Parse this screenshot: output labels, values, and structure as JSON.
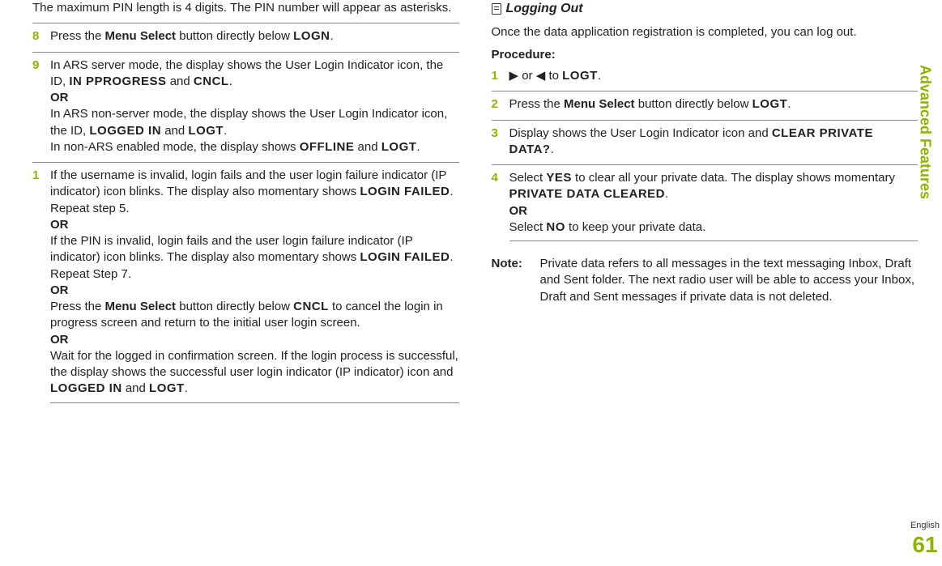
{
  "left": {
    "intro": "The maximum PIN length is 4 digits. The PIN number will appear as asterisks.",
    "s8_num": "8",
    "s8_a": "Press the ",
    "s8_b": "Menu Select",
    "s8_c": " button directly below ",
    "s8_logn": "LOGN",
    "s8_d": ".",
    "s9_num": "9",
    "s9_a": "In ARS server mode, the display shows the User Login Indicator icon, the ID, ",
    "s9_inprog": "IN PPROGRESS",
    "s9_and": " and ",
    "s9_cncl": "CNCL",
    "s9_dot": ".",
    "s9_or1": "OR",
    "s9_b": "In ARS non-server mode, the display shows the User Login Indicator icon, the ID, ",
    "s9_logged": "LOGGED IN",
    "s9_and2": " and ",
    "s9_logt": "LOGT",
    "s9_dot2": ".",
    "s9_c": "In non-ARS enabled mode, the display shows ",
    "s9_offline": "OFFLINE",
    "s9_and3": " and ",
    "s9_logt2": "LOGT",
    "s9_dot3": ".",
    "s1_num": "1",
    "s1_a": "If the username is invalid, login fails and the user login failure indicator (IP indicator) icon blinks. The display also momentary shows ",
    "s1_fail": "LOGIN FAILED",
    "s1_b": ". Repeat step 5.",
    "s1_or1": "OR",
    "s1_c": "If the PIN is invalid, login fails and the user login failure indicator (IP indicator) icon blinks. The display also momentary shows ",
    "s1_fail2": "LOGIN FAILED",
    "s1_d": ". Repeat Step 7.",
    "s1_or2": "OR",
    "s1_e": "Press the ",
    "s1_ms": "Menu Select",
    "s1_f": " button directly below ",
    "s1_cncl": "CNCL",
    "s1_g": " to cancel the login in progress screen and return to the initial user login screen.",
    "s1_or3": "OR",
    "s1_h": "Wait for the logged in confirmation screen. If the login process is successful, the display shows the successful user login indicator (IP indicator) icon and ",
    "s1_logged": "LOGGED IN",
    "s1_and": " and ",
    "s1_logt": "LOGT",
    "s1_dot": "."
  },
  "right": {
    "section": "Logging Out",
    "intro": "Once the data application registration is completed, you can log out.",
    "proc": "Procedure:",
    "r1_num": "1",
    "r1_arrow_r": "▶",
    "r1_or": " or ",
    "r1_arrow_l": "◀",
    "r1_to": " to ",
    "r1_logt": "LOGT",
    "r1_dot": ".",
    "r2_num": "2",
    "r2_a": "Press the ",
    "r2_b": "Menu Select",
    "r2_c": " button directly below ",
    "r2_logt": "LOGT",
    "r2_d": ".",
    "r3_num": "3",
    "r3_a": "Display shows the User Login Indicator icon and ",
    "r3_clear": "CLEAR PRIVATE DATA?",
    "r3_b": ".",
    "r4_num": "4",
    "r4_a": "Select ",
    "r4_yes": "YES",
    "r4_b": " to clear all your private data. The display shows momentary ",
    "r4_cleared": "PRIVATE DATA CLEARED",
    "r4_c": ".",
    "r4_or": "OR",
    "r4_d": "Select ",
    "r4_no": "NO",
    "r4_e": " to keep your private data.",
    "note_label": "Note:",
    "note": "Private data refers to all messages in the text messaging Inbox, Draft and Sent folder. The next radio user will be able to access your Inbox, Draft and Sent messages if private data is not deleted."
  },
  "side": {
    "title": "Advanced Features",
    "lang": "English",
    "page": "61"
  }
}
